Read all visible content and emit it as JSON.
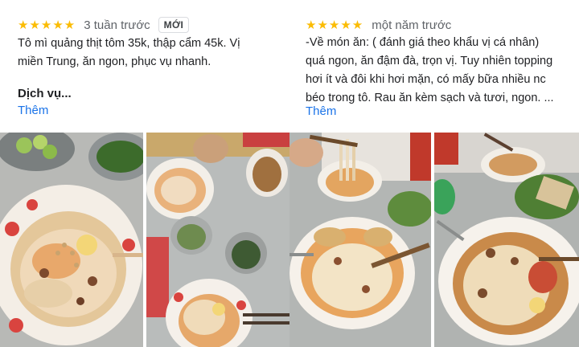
{
  "reviews": [
    {
      "stars": "★★★★★",
      "time": "3 tuần trước",
      "badge": "MỚI",
      "text": "Tô mì quảng thịt tôm 35k, thập cẩm 45k. Vị\nmiền Trung, ăn ngon, phục vụ nhanh.",
      "sub_heading": "Dịch vụ...",
      "more": "Thêm",
      "photos": [
        "bowl-with-lime-photo",
        "table-with-bowls-photo"
      ]
    },
    {
      "stars": "★★★★★",
      "time": "một năm trước",
      "text": "-Về món ăn: ( đánh giá theo khẩu vị cá nhân)\nquá ngon, ăn đậm đà, trọn vị. Tuy nhiên topping\nhơi ít và đôi khi hơi mặn, có mấy bữa nhiều nc\nbéo trong tô. Rau ăn kèm sạch và tươi, ngon. ...",
      "more": "Thêm",
      "photos": [
        "noodles-lifted-photo",
        "bowl-with-greens-photo"
      ]
    }
  ],
  "colors": {
    "star": "#fbbc04",
    "link": "#1a73e8"
  }
}
